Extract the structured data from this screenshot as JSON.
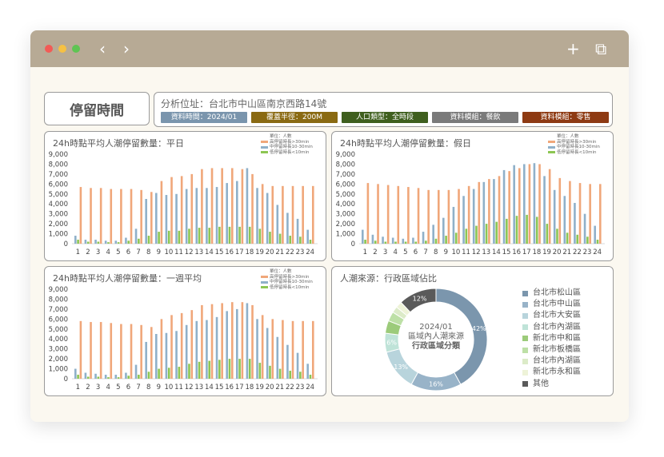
{
  "window": {
    "traffic_lights": [
      "#f25b56",
      "#f6c143",
      "#5fc453"
    ],
    "nav": {
      "back": "‹",
      "forward": "›"
    },
    "actions": {
      "new_tab": "+",
      "tabs": "⧉"
    }
  },
  "header": {
    "title": "停留時間",
    "address": "分析位址：台北市中山區南京西路14號",
    "tags": [
      {
        "label": "資料時間：2024/01",
        "color": "#7a95ad"
      },
      {
        "label": "覆蓋半徑：200M",
        "color": "#8a6a12"
      },
      {
        "label": "人口類型：全時段",
        "color": "#3f5f1e"
      },
      {
        "label": "資料模組：餐飲",
        "color": "#7a7a7a"
      },
      {
        "label": "資料模組：零售",
        "color": "#8e3a12"
      }
    ]
  },
  "legend": {
    "unit": "單位：人數",
    "items": [
      {
        "label": "高停留時長>30min",
        "color": "#f0a77a"
      },
      {
        "label": "中停留時長10-30min",
        "color": "#8fb0c9"
      },
      {
        "label": "低停留時長<10min",
        "color": "#8cc653"
      }
    ]
  },
  "charts": [
    {
      "title": "24h時點平均人潮停留數量：平日",
      "chart_data": {
        "type": "bar",
        "categories": [
          "1",
          "2",
          "3",
          "4",
          "5",
          "6",
          "7",
          "8",
          "9",
          "10",
          "11",
          "12",
          "13",
          "14",
          "15",
          "16",
          "17",
          "18",
          "19",
          "20",
          "21",
          "22",
          "23",
          "24"
        ],
        "ylim": [
          0,
          9000
        ],
        "yticks": [
          "0",
          "1,000",
          "2,000",
          "3,000",
          "4,000",
          "5,000",
          "6,000",
          "7,000",
          "8,000",
          "9,000"
        ],
        "series": [
          {
            "name": "高停留時長>30min",
            "values": [
              5700,
              5600,
              5600,
              5500,
              5500,
              5500,
              5400,
              5200,
              6300,
              6700,
              6800,
              7000,
              7500,
              7600,
              7600,
              7600,
              7500,
              7000,
              6000,
              5800,
              5800,
              5800,
              5800,
              5800
            ]
          },
          {
            "name": "中停留時長10-30min",
            "values": [
              800,
              400,
              400,
              300,
              300,
              600,
              1500,
              4500,
              5100,
              4900,
              5000,
              5500,
              5600,
              5600,
              5700,
              6100,
              6300,
              7600,
              5600,
              5100,
              3900,
              3100,
              2500,
              1400
            ]
          },
          {
            "name": "低停留時長<10min",
            "values": [
              400,
              200,
              200,
              150,
              150,
              300,
              500,
              800,
              1200,
              1300,
              1300,
              1500,
              1600,
              1600,
              1700,
              1700,
              1700,
              1700,
              1500,
              1200,
              1000,
              800,
              700,
              400
            ]
          }
        ]
      }
    },
    {
      "title": "24h時點平均人潮停留數量：假日",
      "chart_data": {
        "type": "bar",
        "categories": [
          "1",
          "2",
          "3",
          "4",
          "5",
          "6",
          "7",
          "8",
          "9",
          "10",
          "11",
          "12",
          "13",
          "14",
          "15",
          "16",
          "17",
          "18",
          "19",
          "20",
          "21",
          "22",
          "23",
          "24"
        ],
        "ylim": [
          0,
          9000
        ],
        "yticks": [
          "0",
          "1,000",
          "2,000",
          "3,000",
          "4,000",
          "5,000",
          "6,000",
          "7,000",
          "8,000",
          "9,000"
        ],
        "series": [
          {
            "name": "高停留時長>30min",
            "values": [
              6100,
              6000,
              5900,
              5800,
              5700,
              5600,
              5400,
              5400,
              5400,
              5500,
              5800,
              6200,
              6500,
              6800,
              7300,
              7600,
              8000,
              8000,
              7500,
              6600,
              6300,
              6100,
              6000,
              6000
            ]
          },
          {
            "name": "中停留時長10-30min",
            "values": [
              1400,
              900,
              700,
              600,
              500,
              600,
              1200,
              1900,
              2600,
              3700,
              4800,
              5500,
              6200,
              6500,
              7400,
              7900,
              8000,
              8100,
              6800,
              5400,
              4800,
              4100,
              3000,
              1800
            ]
          },
          {
            "name": "低停留時長<10min",
            "values": [
              400,
              300,
              200,
              200,
              200,
              200,
              300,
              500,
              800,
              1100,
              1500,
              1800,
              2000,
              2200,
              2500,
              2800,
              2900,
              2700,
              2000,
              1500,
              1100,
              900,
              700,
              400
            ]
          }
        ]
      }
    },
    {
      "title": "24h時點平均人潮停留數量：一週平均",
      "chart_data": {
        "type": "bar",
        "categories": [
          "1",
          "2",
          "3",
          "4",
          "5",
          "6",
          "7",
          "8",
          "9",
          "10",
          "11",
          "12",
          "13",
          "14",
          "15",
          "16",
          "17",
          "18",
          "19",
          "20",
          "21",
          "22",
          "23",
          "24"
        ],
        "ylim": [
          0,
          9000
        ],
        "yticks": [
          "0",
          "1,000",
          "2,000",
          "3,000",
          "4,000",
          "5,000",
          "6,000",
          "7,000",
          "8,000",
          "9,000"
        ],
        "series": [
          {
            "name": "高停留時長>30min",
            "values": [
              5800,
              5700,
              5700,
              5600,
              5500,
              5500,
              5400,
              5200,
              6000,
              6400,
              6600,
              6900,
              7400,
              7500,
              7600,
              7700,
              7700,
              7400,
              6400,
              6000,
              5900,
              5800,
              5800,
              5800
            ]
          },
          {
            "name": "中停留時長10-30min",
            "values": [
              1000,
              600,
              500,
              400,
              400,
              600,
              1400,
              3700,
              4500,
              4600,
              4800,
              5400,
              5800,
              5900,
              6200,
              6800,
              7000,
              7600,
              6000,
              5100,
              4200,
              3400,
              2600,
              1500
            ]
          },
          {
            "name": "低停留時長<10min",
            "values": [
              400,
              200,
              200,
              150,
              150,
              300,
              400,
              700,
              1000,
              1100,
              1200,
              1500,
              1700,
              1800,
              1900,
              2000,
              2000,
              2000,
              1600,
              1300,
              1000,
              800,
              700,
              400
            ]
          }
        ]
      }
    }
  ],
  "donut": {
    "title": "人潮來源：行政區域佔比",
    "center_lines": [
      "2024/01",
      "區域內人潮來源",
      "行政區域分類"
    ],
    "chart_data": {
      "type": "pie",
      "categories": [
        "台北市松山區",
        "台北市中山區",
        "台北市大安區",
        "台北市內湖區",
        "新北市中和區",
        "新北市板橋區",
        "台北市內湖區",
        "新北市永和區",
        "其他"
      ],
      "values": [
        42,
        16,
        13,
        6,
        4,
        3,
        2,
        2,
        12
      ],
      "labels": [
        "42%",
        "16%",
        "13%",
        "6%",
        "",
        "",
        "",
        "",
        "12%"
      ],
      "colors": [
        "#7b96ad",
        "#98b3c8",
        "#b8d4dc",
        "#bfe3d8",
        "#9ccb7a",
        "#bde0a6",
        "#dcebc8",
        "#eef3d8",
        "#5a5a5a"
      ]
    }
  }
}
